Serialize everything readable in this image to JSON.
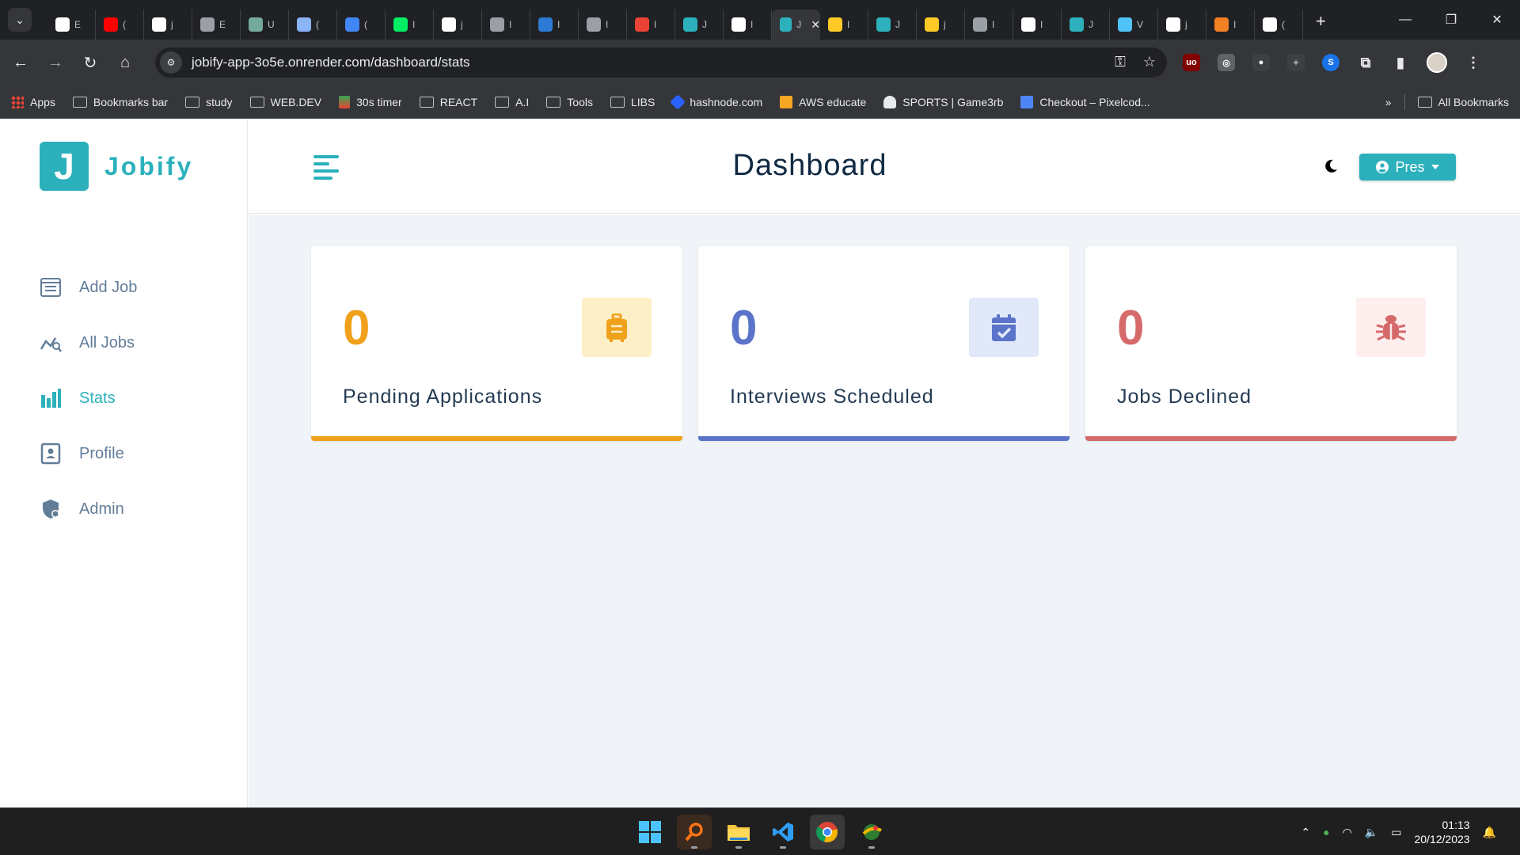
{
  "browser": {
    "tabs": [
      {
        "icon": "figma-like-icon",
        "color": "#ffffff",
        "label": "E"
      },
      {
        "icon": "youtube-icon",
        "color": "#ff0000",
        "label": "("
      },
      {
        "icon": "github-icon",
        "color": "#ffffff",
        "label": "j"
      },
      {
        "icon": "globe-icon",
        "color": "#9aa0a6",
        "label": "E"
      },
      {
        "icon": "chatgpt-icon",
        "color": "#74aa9c",
        "label": "U"
      },
      {
        "icon": "dot-icon",
        "color": "#8ab4f8",
        "label": "("
      },
      {
        "icon": "docs-icon",
        "color": "#4285f4",
        "label": "("
      },
      {
        "icon": "mongodb-icon",
        "color": "#00ed64",
        "label": "I"
      },
      {
        "icon": "github-icon",
        "color": "#ffffff",
        "label": "j"
      },
      {
        "icon": "loading-icon",
        "color": "#9aa0a6",
        "label": "I"
      },
      {
        "icon": "vscode-icon",
        "color": "#2b7ad3",
        "label": "I"
      },
      {
        "icon": "globe-icon",
        "color": "#9aa0a6",
        "label": "I"
      },
      {
        "icon": "x-icon",
        "color": "#ea4335",
        "label": "I"
      },
      {
        "icon": "jobify-icon",
        "color": "#2cb1bc",
        "label": "J"
      },
      {
        "icon": "notion-icon",
        "color": "#ffffff",
        "label": "I"
      },
      {
        "icon": "jobify-icon",
        "color": "#2cb1bc",
        "label": "J",
        "active": true
      },
      {
        "icon": "firebase-icon",
        "color": "#ffca28",
        "label": "I"
      },
      {
        "icon": "jobify-icon",
        "color": "#2cb1bc",
        "label": "J"
      },
      {
        "icon": "firebase-icon",
        "color": "#ffca28",
        "label": "j"
      },
      {
        "icon": "gear-icon",
        "color": "#9aa0a6",
        "label": "I"
      },
      {
        "icon": "github-icon",
        "color": "#ffffff",
        "label": "I"
      },
      {
        "icon": "jobify-icon",
        "color": "#2cb1bc",
        "label": "J"
      },
      {
        "icon": "crosshair-icon",
        "color": "#4fc3f7",
        "label": "V"
      },
      {
        "icon": "vercel-icon",
        "color": "#ffffff",
        "label": "j"
      },
      {
        "icon": "stackoverflow-icon",
        "color": "#f48024",
        "label": "I"
      },
      {
        "icon": "google-icon",
        "color": "#ffffff",
        "label": "("
      }
    ],
    "url": "jobify-app-3o5e.onrender.com/dashboard/stats",
    "bookmarks": [
      {
        "label": "Apps",
        "icon": "apps"
      },
      {
        "label": "Bookmarks bar",
        "icon": "folder"
      },
      {
        "label": "study",
        "icon": "folder"
      },
      {
        "label": "WEB.DEV",
        "icon": "folder"
      },
      {
        "label": "30s timer",
        "icon": "timer"
      },
      {
        "label": "REACT",
        "icon": "folder"
      },
      {
        "label": "A.I",
        "icon": "folder"
      },
      {
        "label": "Tools",
        "icon": "folder"
      },
      {
        "label": "LIBS",
        "icon": "folder"
      },
      {
        "label": "hashnode.com",
        "icon": "diamond"
      },
      {
        "label": "AWS educate",
        "icon": "box"
      },
      {
        "label": "SPORTS | Game3rb",
        "icon": "skull"
      },
      {
        "label": "Checkout – Pixelcod...",
        "icon": "pixel"
      }
    ],
    "all_bookmarks_label": "All Bookmarks"
  },
  "app": {
    "logo_letter": "J",
    "logo_text": "Jobify",
    "nav": [
      {
        "label": "Add Job",
        "icon": "add-job-icon"
      },
      {
        "label": "All Jobs",
        "icon": "all-jobs-icon"
      },
      {
        "label": "Stats",
        "icon": "stats-icon",
        "active": true
      },
      {
        "label": "Profile",
        "icon": "profile-icon"
      },
      {
        "label": "Admin",
        "icon": "admin-icon"
      }
    ],
    "page_title": "Dashboard",
    "user_button_label": "Pres",
    "stats": [
      {
        "count": "0",
        "title": "Pending Applications",
        "color": "#e9b949",
        "accent": "#f0a11c",
        "bg": "#fcefc7",
        "icon": "suitcase-icon"
      },
      {
        "count": "0",
        "title": "Interviews Scheduled",
        "color": "#647acb",
        "accent": "#5b74c9",
        "bg": "#e0e8f9",
        "icon": "calendar-check-icon"
      },
      {
        "count": "0",
        "title": "Jobs Declined",
        "color": "#d66a6a",
        "accent": "#d66a6a",
        "bg": "#ffeeee",
        "icon": "bug-icon"
      }
    ],
    "colors": {
      "primary": "#2cb1bc",
      "text_dark": "#102a43",
      "nav_text": "#627d98"
    }
  },
  "taskbar": {
    "time": "01:13",
    "date": "20/12/2023"
  }
}
